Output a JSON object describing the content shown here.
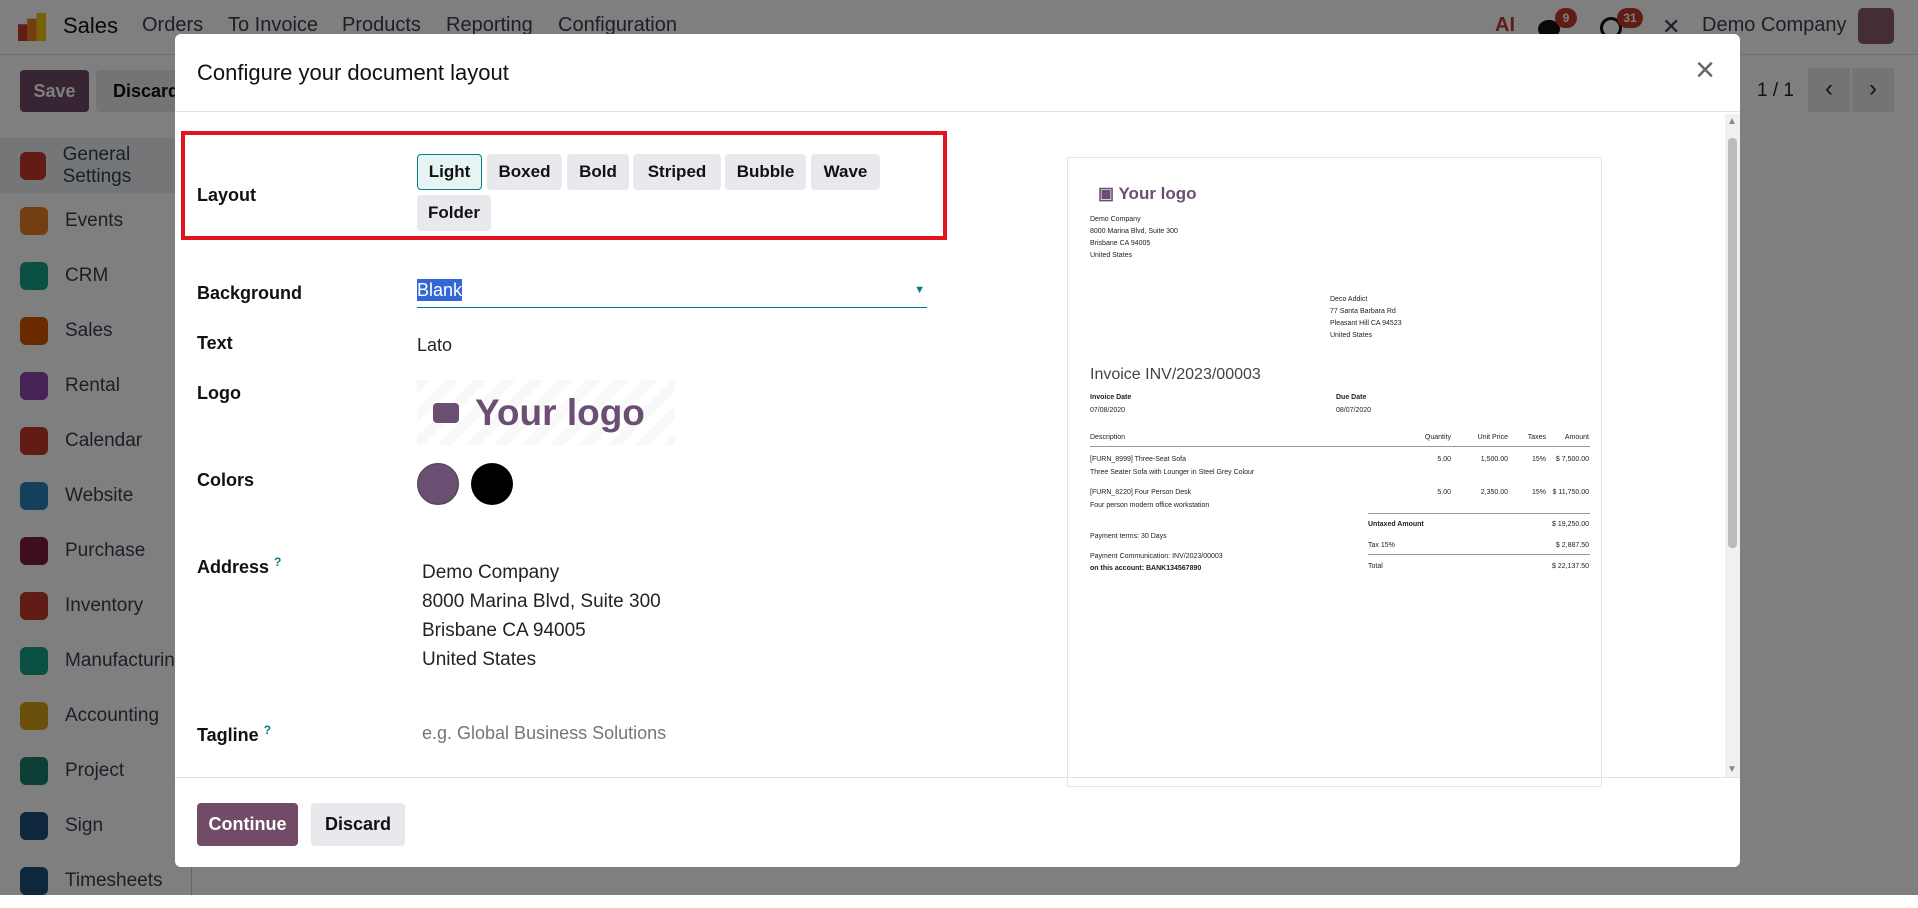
{
  "topbar": {
    "app": "Sales",
    "menu": [
      "Orders",
      "To Invoice",
      "Products",
      "Reporting",
      "Configuration"
    ],
    "ai_label": "AI",
    "messages_badge": "9",
    "activities_badge": "31",
    "company": "Demo Company"
  },
  "control": {
    "save": "Save",
    "discard": "Discard",
    "pager": "1 / 1"
  },
  "sidebar": [
    "General Settings",
    "Events",
    "CRM",
    "Sales",
    "Rental",
    "Calendar",
    "Website",
    "Purchase",
    "Inventory",
    "Manufacturing",
    "Accounting",
    "Project",
    "Sign",
    "Timesheets"
  ],
  "modal": {
    "title": "Configure your document layout",
    "layout_label": "Layout",
    "layouts": [
      "Light",
      "Boxed",
      "Bold",
      "Striped",
      "Bubble",
      "Wave",
      "Folder"
    ],
    "selected_layout": "Light",
    "background_label": "Background",
    "background_value": "Blank",
    "text_label": "Text",
    "text_value": "Lato",
    "logo_label": "Logo",
    "logo_text": "Your logo",
    "colors_label": "Colors",
    "colors": [
      "#6b4f73",
      "#000000"
    ],
    "address_label": "Address",
    "help_mark": "?",
    "address": [
      "Demo Company",
      "8000 Marina Blvd, Suite 300",
      "Brisbane CA 94005",
      "United States"
    ],
    "tagline_label": "Tagline",
    "tagline_placeholder": "e.g. Global Business Solutions",
    "continue": "Continue",
    "discard": "Discard"
  },
  "preview": {
    "logo": "Your logo",
    "company": [
      "Demo Company",
      "8000 Marina Blvd, Suite 300",
      "Brisbane CA 94005",
      "United States"
    ],
    "customer": [
      "Deco Addict",
      "77 Santa Barbara Rd",
      "Pleasant Hill CA 94523",
      "United States"
    ],
    "title": "Invoice INV/2023/00003",
    "invoice_date_label": "Invoice Date",
    "invoice_date": "07/08/2020",
    "due_date_label": "Due Date",
    "due_date": "08/07/2020",
    "columns": [
      "Description",
      "Quantity",
      "Unit Price",
      "Taxes",
      "Amount"
    ],
    "lines": [
      {
        "name": "[FURN_8999] Three-Seat Sofa",
        "desc": "Three Seater Sofa with Lounger in Steel Grey Colour",
        "qty": "5.00",
        "price": "1,500.00",
        "tax": "15%",
        "amount": "$ 7,500.00"
      },
      {
        "name": "[FURN_8220] Four Person Desk",
        "desc": "Four person modern office workstation",
        "qty": "5.00",
        "price": "2,350.00",
        "tax": "15%",
        "amount": "$ 11,750.00"
      }
    ],
    "untaxed_label": "Untaxed Amount",
    "untaxed": "$ 19,250.00",
    "tax_label": "Tax 15%",
    "tax": "$ 2,887.50",
    "total_label": "Total",
    "total": "$ 22,137.50",
    "payment_terms": "Payment terms: 30 Days",
    "payment_comm": "Payment Communication: INV/2023/00003",
    "payment_account": "on this account: BANK134567890"
  },
  "colors": {
    "primary": "#714b67",
    "accent": "#017e84",
    "highlight": "#e3141f"
  }
}
